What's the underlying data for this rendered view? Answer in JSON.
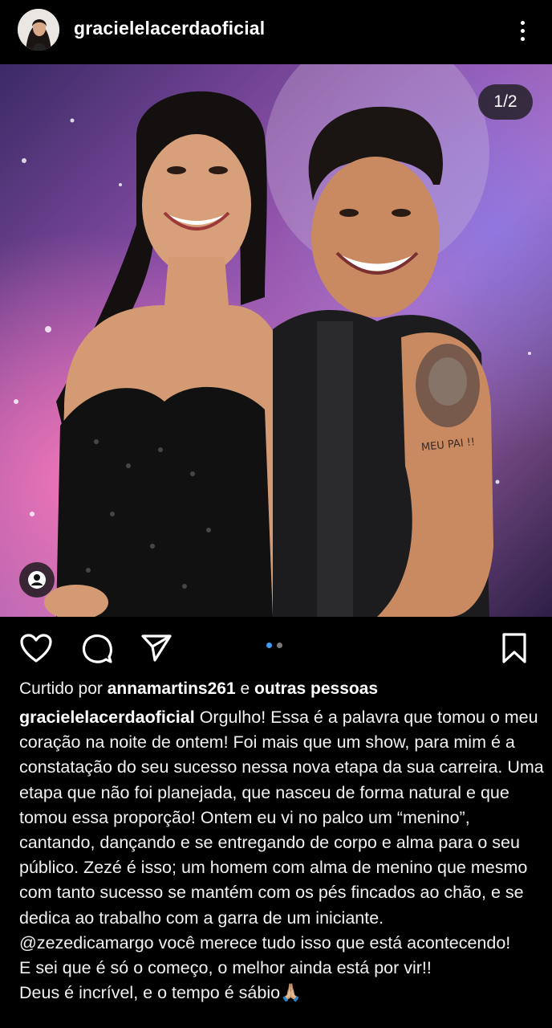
{
  "header": {
    "username": "gracielelacerdaoficial"
  },
  "post": {
    "carousel_counter": "1/2",
    "carousel_position": 1,
    "carousel_total": 2,
    "tattoo_text": "MEU PAI !!"
  },
  "likes": {
    "prefix": "Curtido por",
    "user": "annamartins261",
    "connector": "e",
    "others": "outras pessoas"
  },
  "caption": {
    "author": "gracielelacerdaoficial",
    "paragraph1": "Orgulho! Essa é a palavra que tomou o meu coração na noite de ontem! Foi mais que um show, para mim é a constatação do seu sucesso nessa nova etapa da sua carreira. Uma etapa que não foi planejada, que nasceu de forma natural e que tomou essa proporção! Ontem eu vi no palco um “menino”, cantando, dançando e se entregando de corpo e alma para o seu público. Zezé é isso; um homem com alma de menino que mesmo com tanto sucesso se mantém com os pés fincados ao chão, e se dedica ao trabalho com a garra de um iniciante.",
    "mention": "@zezedicamargo",
    "line2": "você merece tudo isso que está acontecendo!",
    "line3": "E sei que é só o começo, o melhor ainda está por vir!!",
    "line4": "Deus é incrível, e o tempo é sábio🙏🏼"
  },
  "icons": {
    "more": "more-vertical-icon",
    "like": "heart-icon",
    "comment": "comment-icon",
    "share": "send-icon",
    "save": "bookmark-icon",
    "tags": "user-tag-icon"
  },
  "colors": {
    "background": "#000000",
    "text": "#f1f1f1",
    "carousel_active": "#3d9cf5",
    "carousel_inactive": "#7a7a7a"
  }
}
